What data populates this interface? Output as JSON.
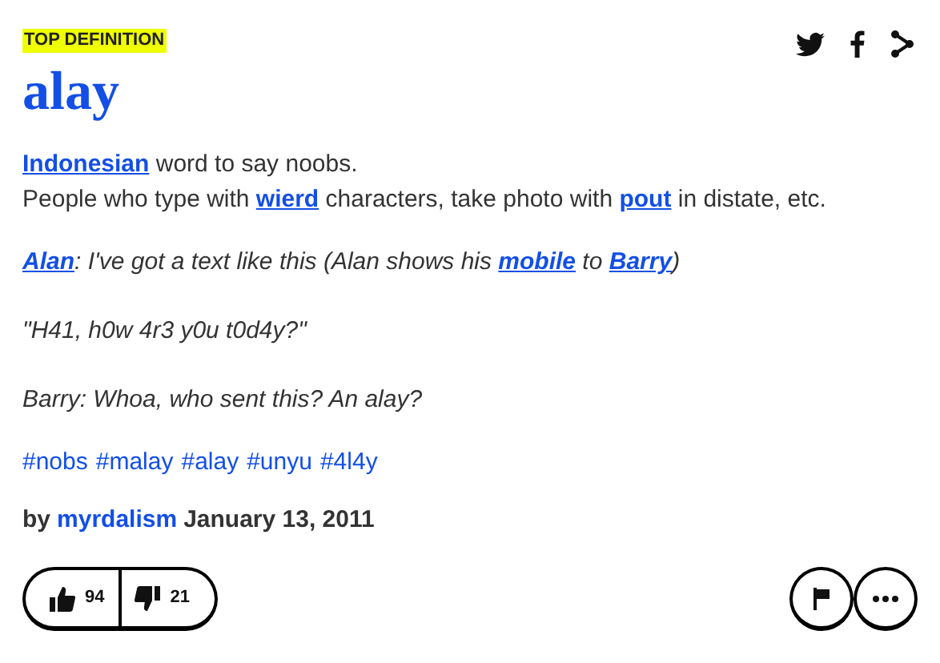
{
  "badge": "TOP DEFINITION",
  "word": "alay",
  "meaning": [
    {
      "segments": [
        {
          "text": "Indonesian",
          "kind": "link"
        },
        {
          "text": " word to say noobs.",
          "kind": "text"
        }
      ]
    },
    {
      "segments": [
        {
          "text": "People who type with ",
          "kind": "text"
        },
        {
          "text": "wierd",
          "kind": "link"
        },
        {
          "text": " characters, take photo with ",
          "kind": "text"
        },
        {
          "text": "pout",
          "kind": "link"
        },
        {
          "text": " in distate, etc.",
          "kind": "text"
        }
      ]
    }
  ],
  "example": [
    {
      "segments": [
        {
          "text": "Alan",
          "kind": "link"
        },
        {
          "text": ": I've got a text like this (Alan shows his ",
          "kind": "text"
        },
        {
          "text": "mobile",
          "kind": "link"
        },
        {
          "text": " to ",
          "kind": "text"
        },
        {
          "text": "Barry",
          "kind": "link"
        },
        {
          "text": ")",
          "kind": "text"
        }
      ]
    },
    {
      "segments": [
        {
          "text": "\"H41, h0w 4r3 y0u t0d4y?\"",
          "kind": "text"
        }
      ]
    },
    {
      "segments": [
        {
          "text": "Barry: Whoa, who sent this? An alay?",
          "kind": "text"
        }
      ]
    }
  ],
  "tags": [
    "#nobs",
    "#malay",
    "#alay",
    "#unyu",
    "#4l4y"
  ],
  "byline": {
    "prefix": "by",
    "author": "myrdalism",
    "date": "January 13, 2011"
  },
  "votes": {
    "up": "94",
    "down": "21"
  }
}
